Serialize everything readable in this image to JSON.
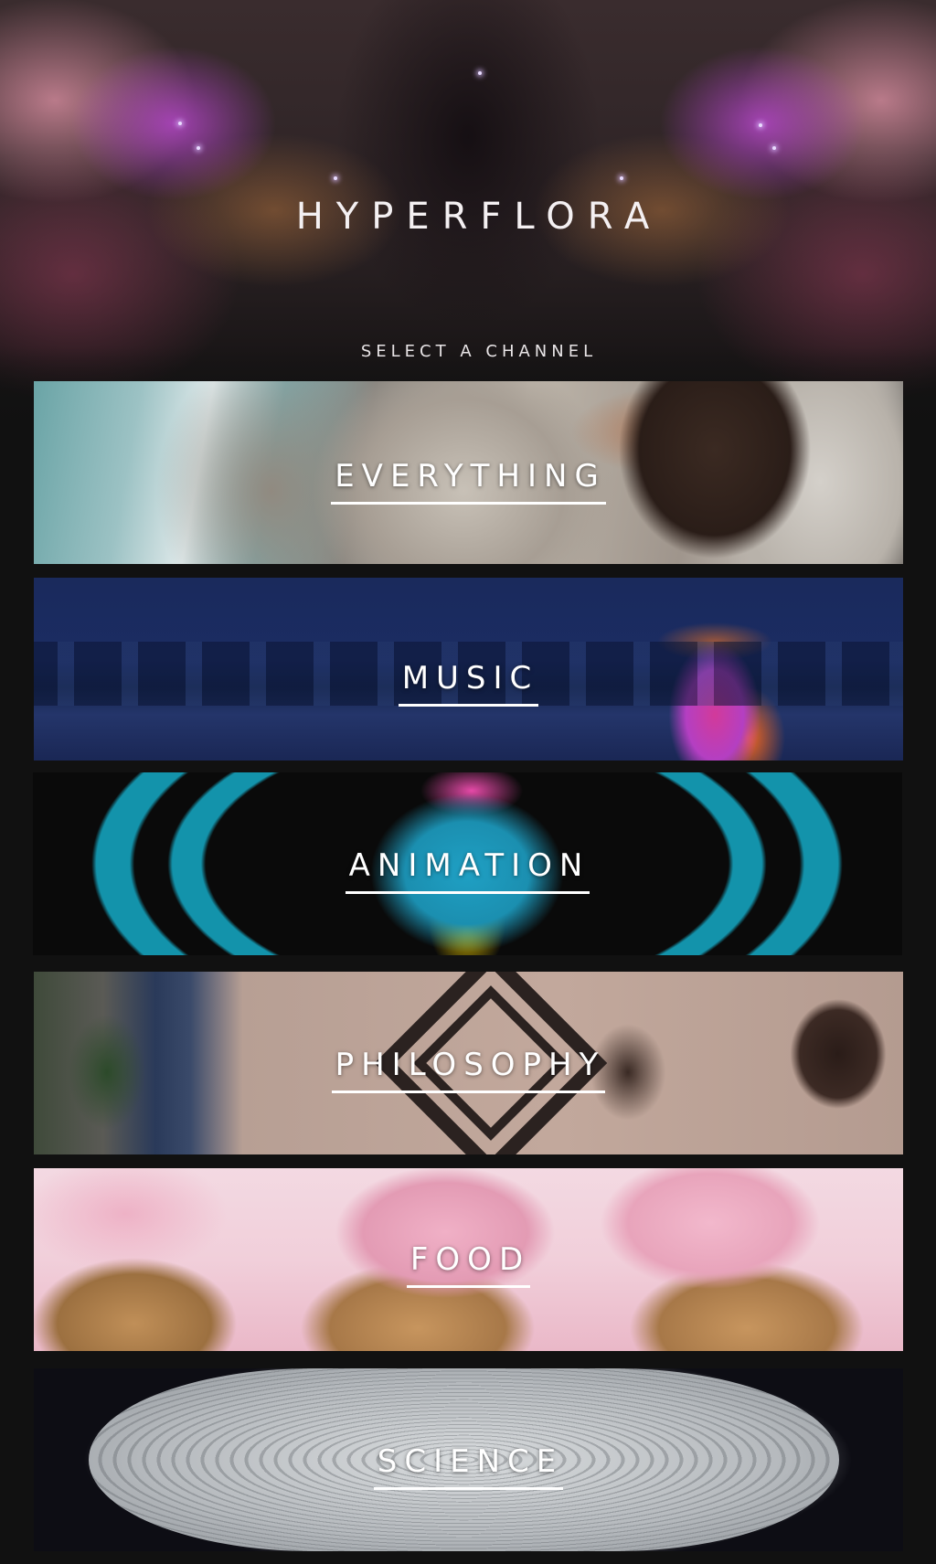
{
  "header": {
    "title": "HYPERFLORA",
    "subtitle": "SELECT A CHANNEL"
  },
  "channels": [
    {
      "label": "EVERYTHING",
      "image": "astronaut-over-earth"
    },
    {
      "label": "MUSIC",
      "image": "neon-deer-landscape"
    },
    {
      "label": "ANIMATION",
      "image": "cartoon-creature-cyan-rings"
    },
    {
      "label": "PHILOSOPHY",
      "image": "men-with-diamond-frames"
    },
    {
      "label": "FOOD",
      "image": "pink-glazed-cream-puffs"
    },
    {
      "label": "SCIENCE",
      "image": "white-3d-flower-pattern"
    }
  ],
  "colors": {
    "background": "#111111",
    "text": "#ffffff"
  }
}
